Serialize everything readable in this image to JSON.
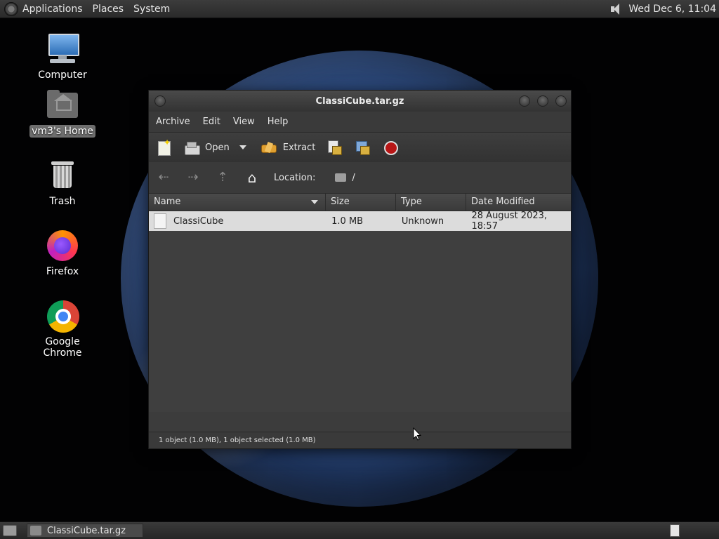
{
  "top_panel": {
    "menus": [
      "Applications",
      "Places",
      "System"
    ],
    "clock": "Wed Dec 6, 11:04"
  },
  "desktop": {
    "icons": [
      {
        "label": "Computer"
      },
      {
        "label": "vm3's Home"
      },
      {
        "label": "Trash"
      },
      {
        "label": "Firefox"
      },
      {
        "label": "Google Chrome"
      }
    ]
  },
  "window": {
    "title": "ClassiCube.tar.gz",
    "menu": [
      "Archive",
      "Edit",
      "View",
      "Help"
    ],
    "toolbar": {
      "open_label": "Open",
      "extract_label": "Extract"
    },
    "location": {
      "label": "Location:",
      "path": "/"
    },
    "columns": [
      "Name",
      "Size",
      "Type",
      "Date Modified"
    ],
    "rows": [
      {
        "name": "ClassiCube",
        "size": "1.0 MB",
        "type": "Unknown",
        "date": "28 August 2023, 18:57"
      }
    ],
    "status": "1 object (1.0 MB), 1 object selected (1.0 MB)"
  },
  "taskbar": {
    "tasks": [
      {
        "label": "ClassiCube.tar.gz"
      }
    ]
  }
}
